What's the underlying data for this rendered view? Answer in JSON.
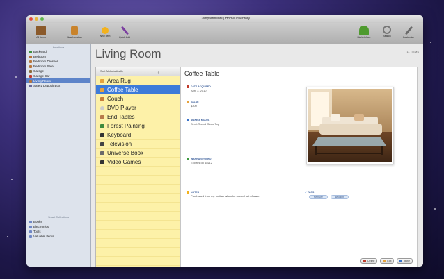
{
  "window": {
    "title": "Compartments | Home Inventory"
  },
  "toolbar": {
    "left": [
      {
        "label": "All Items",
        "icon": "house-icon",
        "color": "#8b5a2b"
      },
      {
        "label": "New Location",
        "icon": "door-icon",
        "color": "#c9832b"
      },
      {
        "label": "New Item",
        "icon": "star-icon",
        "color": "#f3b21d"
      },
      {
        "label": "Quick Add",
        "icon": "wand-icon",
        "color": "#7b3fa0"
      }
    ],
    "right": [
      {
        "label": "Marketplace",
        "icon": "plant-icon",
        "color": "#4e9a2e"
      },
      {
        "label": "Search",
        "icon": "magnifier-icon",
        "color": "#777777"
      },
      {
        "label": "Customize",
        "icon": "tools-icon",
        "color": "#6a6a6a"
      }
    ]
  },
  "sidebar": {
    "locations_header": "Locations",
    "locations": [
      {
        "label": "Backyard",
        "color": "#3f8f3f"
      },
      {
        "label": "Bedroom",
        "color": "#b8743a"
      },
      {
        "label": "Bedroom Dresser",
        "color": "#b8743a"
      },
      {
        "label": "Bedroom Safe",
        "color": "#b8743a"
      },
      {
        "label": "Garage",
        "color": "#8a6a3a"
      },
      {
        "label": "Garage Car",
        "color": "#c03a2b"
      },
      {
        "label": "Living Room",
        "color": "#b8743a",
        "selected": true
      },
      {
        "label": "Safety Deposit Box",
        "color": "#6a6a9a"
      }
    ],
    "smart_header": "Smart Collections",
    "smart": [
      {
        "label": "Books",
        "color": "#6f87c6"
      },
      {
        "label": "Electronics",
        "color": "#6f87c6"
      },
      {
        "label": "Tools",
        "color": "#6f87c6"
      },
      {
        "label": "Valuable Items",
        "color": "#6f87c6"
      }
    ]
  },
  "room": {
    "title": "Living Room",
    "count": "11 ITEMS"
  },
  "list": {
    "sort_label": "Sort Alphabetically",
    "items": [
      {
        "label": "Area Rug",
        "color": "#e6a23c"
      },
      {
        "label": "Coffee Table",
        "color": "#e6a23c",
        "selected": true
      },
      {
        "label": "Couch",
        "color": "#c97f3b"
      },
      {
        "label": "DVD Player",
        "color": "#cccccc"
      },
      {
        "label": "End Tables",
        "color": "#b87a4b"
      },
      {
        "label": "Forest Painting",
        "color": "#3d8a3d"
      },
      {
        "label": "Keyboard",
        "color": "#333333"
      },
      {
        "label": "Television",
        "color": "#444444"
      },
      {
        "label": "Universe Book",
        "color": "#6a6a6a"
      },
      {
        "label": "Video Games",
        "color": "#333333"
      }
    ]
  },
  "detail": {
    "title": "Coffee Table",
    "fields": [
      {
        "label": "DATE ACQUIRED",
        "value": "April 3, 2010",
        "color": "#c03a2b"
      },
      {
        "label": "VALUE",
        "value": "$300",
        "color": "#e6a23c"
      },
      {
        "label": "MAKE & MODEL",
        "value": "Semi-Round Glass Top",
        "color": "#3a73c9"
      },
      {
        "label": "WARRANTY INFO",
        "value": "Expires on 4/3/12",
        "color": "#3d9a3d"
      },
      {
        "label": "NOTES",
        "value": "Purchased from my mother when he moved out of state.",
        "color": "#f3b21d"
      }
    ],
    "tags_label": "TAGS",
    "tags": [
      "furniture",
      "wooden"
    ],
    "buttons": [
      {
        "label": "Delete",
        "color": "#c03a2b"
      },
      {
        "label": "Edit",
        "color": "#e6a23c"
      },
      {
        "label": "Move",
        "color": "#3a73c9"
      }
    ]
  }
}
